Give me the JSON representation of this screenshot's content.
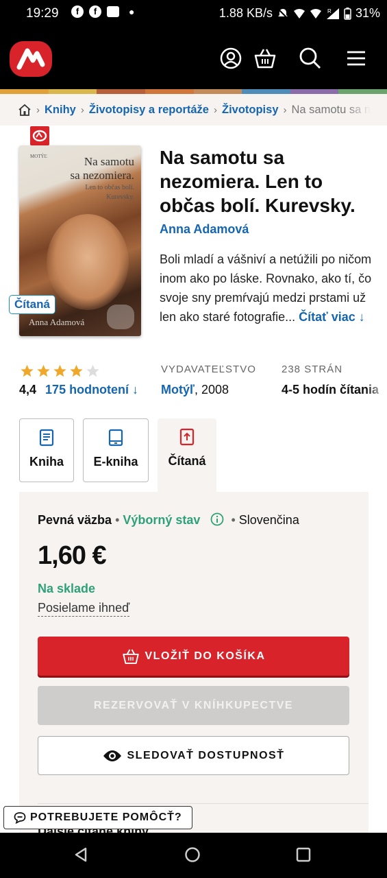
{
  "status_bar": {
    "time": "19:29",
    "speed": "1.88 KB/s",
    "battery": "31%",
    "signal_tag": "R"
  },
  "breadcrumb": {
    "items": [
      "Knihy",
      "Životopisy a reportáže",
      "Životopisy"
    ],
    "current": "Na samotu sa n"
  },
  "book": {
    "title": "Na samotu sa nezomiera. Len to občas bolí. Kurevsky.",
    "author": "Anna Adamová",
    "description": "Boli mladí a vášniví a netúžili po ničom inom ako po láske. Rovnako, ako tí, čo svoje sny premŕvajú medzi prstami už len ako staré fotografie...",
    "read_more": "Čítať viac ↓",
    "cover": {
      "publisher": "MOTÝĽ",
      "title_line1": "Na samotu",
      "title_line2": "sa nezomiera.",
      "subtitle_line1": "Len to občas bolí.",
      "subtitle_line2": "Kurevsky.",
      "author": "Anna Adamová"
    },
    "used_tag": "Čítaná"
  },
  "rating": {
    "value": "4,4",
    "count": "175 hodnotení ↓",
    "stars_filled": 4,
    "stars_total": 5
  },
  "publisher": {
    "label": "VYDAVATEĽSTVO",
    "name": "Motýľ",
    "year": ", 2008"
  },
  "pages": {
    "label": "238 STRÁN",
    "reading_time": "4-5 hodín čítania"
  },
  "tabs": [
    {
      "label": "Kniha",
      "icon": "book-icon",
      "active": false
    },
    {
      "label": "E-kniha",
      "icon": "ereader-icon",
      "active": false
    },
    {
      "label": "Čítaná",
      "icon": "recycled-book-icon",
      "active": true
    }
  ],
  "offer": {
    "binding": "Pevná väzba",
    "condition": "Výborný stav",
    "language": "Slovenčina",
    "price": "1,60 €",
    "stock": "Na sklade",
    "shipping": "Posielame ihneď"
  },
  "buttons": {
    "cart": "VLOŽIŤ DO KOŠÍKA",
    "reserve": "REZERVOVAŤ V KNÍHKUPECTVE",
    "watch": "SLEDOVAŤ DOSTUPNOSŤ"
  },
  "next_section": "Ďalšie čítané knihy",
  "help_button": "POTREBUJETE POMÔCŤ?",
  "colors": {
    "brand_red": "#d8232a",
    "link_blue": "#1565b0",
    "success_green": "#2fa17a",
    "panel_bg": "#f7f3f1"
  }
}
